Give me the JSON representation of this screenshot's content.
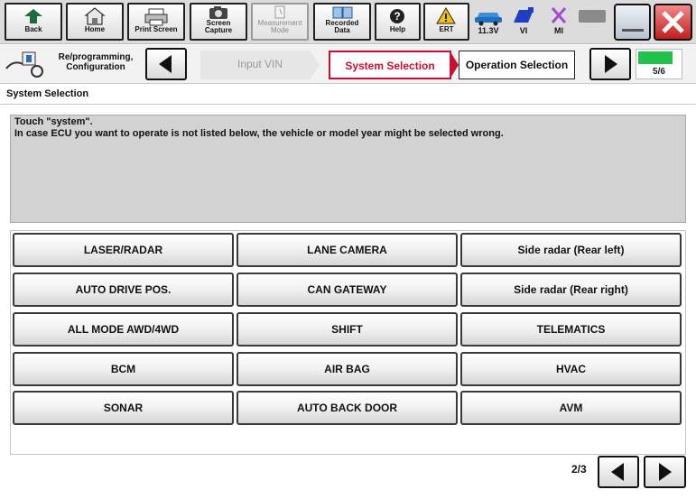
{
  "toolbar": {
    "back_label": "Back",
    "home_label": "Home",
    "print_label": "Print Screen",
    "capture_label": "Screen\nCapture",
    "measurement_label": "Measurement\nMode",
    "recorded_label": "Recorded\nData",
    "help_label": "Help",
    "ert_label": "ERT",
    "voltage_label": "11.3V",
    "vi_label": "VI",
    "mi_label": "MI"
  },
  "breadcrumb": {
    "mode_label": "Re/programming,\nConfiguration",
    "steps": [
      {
        "label": "Input VIN",
        "state": "inactive"
      },
      {
        "label": "System Selection",
        "state": "active"
      },
      {
        "label": "Operation Selection",
        "state": "next"
      }
    ],
    "progress": {
      "current": 5,
      "total": 6,
      "text": "5/6"
    }
  },
  "page": {
    "title": "System Selection",
    "message_line1": "Touch \"system\".",
    "message_line2": "In case ECU you want to operate is not listed below, the vehicle or model year might be selected wrong."
  },
  "systems": [
    [
      "LASER/RADAR",
      "LANE CAMERA",
      "Side radar (Rear left)"
    ],
    [
      "AUTO DRIVE POS.",
      "CAN GATEWAY",
      "Side radar (Rear right)"
    ],
    [
      "ALL MODE AWD/4WD",
      "SHIFT",
      "TELEMATICS"
    ],
    [
      "BCM",
      "AIR BAG",
      "HVAC"
    ],
    [
      "SONAR",
      "AUTO BACK DOOR",
      "AVM"
    ]
  ],
  "pagination": {
    "text": "2/3"
  },
  "colors": {
    "active_step": "#c8102e",
    "progress_fill": "#22c34a",
    "close_button": "#c41e1e",
    "message_bg": "#d2d2d2"
  }
}
